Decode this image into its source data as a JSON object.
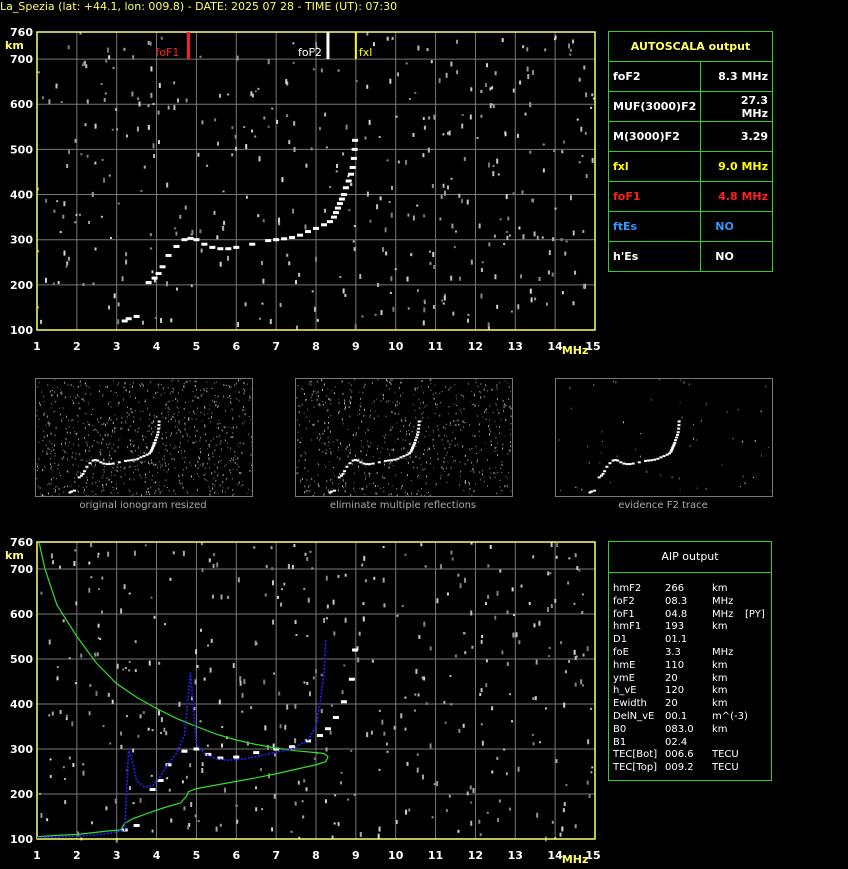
{
  "title": "La_Spezia (lat: +44.1, lon: 009.8) - DATE: 2025 07 28 - TIME (UT): 07:30",
  "colors": {
    "frame": "#ffff66",
    "grid": "#777777",
    "fof1": "#ff2020",
    "fxl": "#ffff00",
    "es": "#3399ff",
    "table_border": "#33cc33",
    "trace": "#ffffff",
    "model": "#33dd33",
    "fit": "#2222ff"
  },
  "axes": {
    "x_unit": "MHz",
    "y_unit": "km",
    "x_ticks": [
      "1",
      "2",
      "3",
      "4",
      "5",
      "6",
      "7",
      "8",
      "9",
      "10",
      "11",
      "12",
      "13",
      "14",
      "15"
    ],
    "y_ticks": [
      "100",
      "200",
      "300",
      "400",
      "500",
      "600",
      "700",
      "760"
    ],
    "xlim": [
      1,
      15
    ],
    "ylim": [
      100,
      760
    ]
  },
  "markers": {
    "fof1": {
      "label": "foF1",
      "freq": 4.8
    },
    "fof2": {
      "label": "foF2",
      "freq": 8.3
    },
    "fxl": {
      "label": "fxl",
      "freq": 9.0
    }
  },
  "autoscala": {
    "header": "AUTOSCALA output",
    "rows": [
      {
        "label": "foF2",
        "value": "8.3 MHz",
        "color": "#ffffff"
      },
      {
        "label": "MUF(3000)F2",
        "value": "27.3 MHz",
        "color": "#ffffff"
      },
      {
        "label": "M(3000)F2",
        "value": "3.29",
        "color": "#ffffff"
      },
      {
        "label": "fxl",
        "value": "9.0 MHz",
        "color": "#ffff00"
      },
      {
        "label": "foF1",
        "value": "4.8 MHz",
        "color": "#ff2020"
      },
      {
        "label": "ftEs",
        "value": "NO",
        "color": "#3399ff"
      },
      {
        "label": "h'Es",
        "value": "NO",
        "color": "#ffffff"
      }
    ]
  },
  "thumbnails": [
    {
      "caption": "original ionogram resized"
    },
    {
      "caption": "eliminate multiple reflections"
    },
    {
      "caption": "evidence F2 trace"
    }
  ],
  "aip": {
    "header": "AIP output",
    "rows": [
      {
        "name": "hmF2",
        "value": "266",
        "unit": "km",
        "extra": ""
      },
      {
        "name": "foF2",
        "value": "08.3",
        "unit": "MHz",
        "extra": ""
      },
      {
        "name": "foF1",
        "value": "04.8",
        "unit": "MHz",
        "extra": "[PY]"
      },
      {
        "name": "hmF1",
        "value": "193",
        "unit": "km",
        "extra": ""
      },
      {
        "name": "D1",
        "value": "01.1",
        "unit": "",
        "extra": ""
      },
      {
        "name": "foE",
        "value": "3.3",
        "unit": "MHz",
        "extra": ""
      },
      {
        "name": "hmE",
        "value": "110",
        "unit": "km",
        "extra": ""
      },
      {
        "name": "ymE",
        "value": "20",
        "unit": "km",
        "extra": ""
      },
      {
        "name": "h_vE",
        "value": "120",
        "unit": "km",
        "extra": ""
      },
      {
        "name": "Ewidth",
        "value": "20",
        "unit": "km",
        "extra": ""
      },
      {
        "name": "DelN_vE",
        "value": "00.1",
        "unit": "m^(-3)",
        "extra": ""
      },
      {
        "name": "B0",
        "value": "083.0",
        "unit": "km",
        "extra": ""
      },
      {
        "name": "B1",
        "value": "02.4",
        "unit": "",
        "extra": ""
      },
      {
        "name": "TEC[Bot]",
        "value": "006.6",
        "unit": "TECU",
        "extra": ""
      },
      {
        "name": "TEC[Top]",
        "value": "009.2",
        "unit": "TECU",
        "extra": ""
      }
    ]
  },
  "chart_data": [
    {
      "type": "scatter",
      "xlabel": "MHz",
      "ylabel": "km",
      "xlim": [
        1,
        15
      ],
      "ylim": [
        100,
        760
      ],
      "series": [
        {
          "role": "trace",
          "x": [
            3.2,
            3.3,
            3.5,
            3.8,
            3.95,
            4.05,
            4.15,
            4.3,
            4.5,
            4.7,
            4.85,
            5.0,
            5.2,
            5.4,
            5.6,
            5.8,
            6.0,
            6.4,
            6.8,
            7.0,
            7.2,
            7.4,
            7.6,
            7.8,
            8.0,
            8.2,
            8.35,
            8.45,
            8.5,
            8.55,
            8.6,
            8.65,
            8.7,
            8.75,
            8.82,
            8.88,
            8.92,
            8.95,
            8.97,
            8.98
          ],
          "y": [
            120,
            125,
            130,
            205,
            215,
            225,
            240,
            265,
            285,
            300,
            303,
            300,
            290,
            283,
            280,
            280,
            283,
            290,
            298,
            300,
            302,
            305,
            310,
            318,
            325,
            333,
            340,
            350,
            360,
            370,
            380,
            390,
            400,
            415,
            430,
            445,
            460,
            480,
            500,
            520
          ]
        }
      ]
    },
    {
      "type": "line",
      "xlabel": "MHz",
      "ylabel": "km",
      "xlim": [
        1,
        15
      ],
      "ylim": [
        100,
        760
      ],
      "series": [
        {
          "role": "trace",
          "x": [
            3.2,
            3.5,
            3.9,
            4.1,
            4.3,
            4.7,
            5.0,
            5.3,
            5.6,
            6.0,
            6.5,
            7.0,
            7.4,
            7.8,
            8.1,
            8.3,
            8.5,
            8.7,
            8.9,
            8.98
          ],
          "y": [
            120,
            130,
            210,
            230,
            265,
            295,
            300,
            288,
            280,
            282,
            292,
            300,
            305,
            318,
            330,
            345,
            370,
            405,
            455,
            520
          ]
        },
        {
          "role": "model",
          "x": [
            1.05,
            1.2,
            1.5,
            2.0,
            2.5,
            3.0,
            3.5,
            4.0,
            4.5,
            5.0,
            5.5,
            6.0,
            6.5,
            7.0,
            7.5,
            8.0,
            8.2,
            8.3,
            8.25,
            8.0,
            7.5,
            7.0,
            6.5,
            6.0,
            5.5,
            5.0,
            4.8,
            4.75,
            4.6,
            4.2,
            3.8,
            3.4,
            3.3,
            3.2,
            3.1,
            2.8,
            2.0,
            1.5,
            1.0
          ],
          "y": [
            760,
            700,
            620,
            550,
            490,
            445,
            415,
            390,
            368,
            350,
            333,
            320,
            310,
            302,
            296,
            292,
            290,
            283,
            272,
            265,
            255,
            245,
            236,
            228,
            220,
            212,
            205,
            195,
            180,
            170,
            158,
            145,
            140,
            135,
            120,
            118,
            110,
            108,
            105
          ]
        },
        {
          "role": "fit",
          "x": [
            1.0,
            2.0,
            2.8,
            3.2,
            3.3,
            3.4,
            3.5,
            3.7,
            3.9,
            4.1,
            4.3,
            4.5,
            4.7,
            4.85,
            5.0,
            5.2,
            5.5,
            5.8,
            6.2,
            6.6,
            7.0,
            7.4,
            7.8,
            8.0,
            8.1,
            8.2,
            8.25
          ],
          "y": [
            103,
            106,
            112,
            120,
            300,
            270,
            230,
            215,
            218,
            240,
            268,
            290,
            330,
            470,
            310,
            290,
            278,
            275,
            278,
            285,
            293,
            300,
            320,
            350,
            400,
            470,
            545
          ]
        }
      ]
    }
  ]
}
